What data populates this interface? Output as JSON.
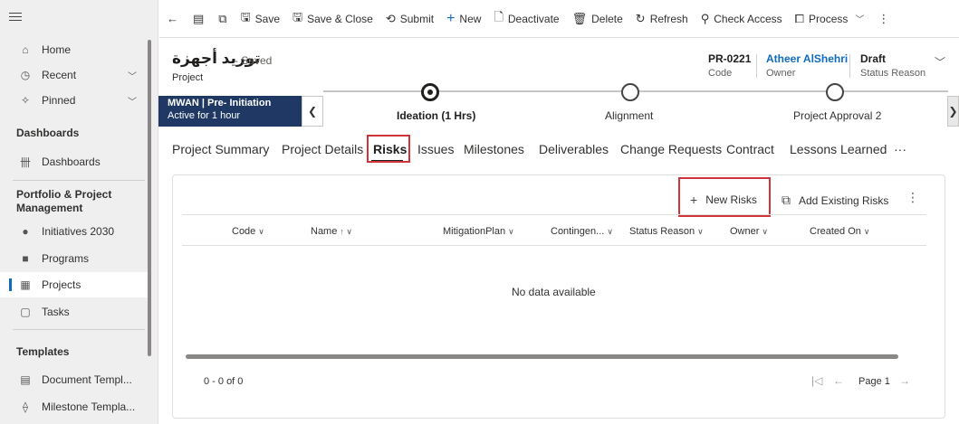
{
  "sidebar": {
    "items": [
      {
        "label": "Home",
        "icon": "home-icon"
      },
      {
        "label": "Recent",
        "icon": "clock-icon"
      },
      {
        "label": "Pinned",
        "icon": "pin-icon"
      }
    ],
    "section_dashboards": "Dashboards",
    "dashboards_item": "Dashboards",
    "section_portfolio": "Portfolio & Project Management",
    "portfolio_items": [
      {
        "label": "Initiatives 2030"
      },
      {
        "label": "Programs"
      },
      {
        "label": "Projects"
      },
      {
        "label": "Tasks"
      }
    ],
    "section_templates": "Templates",
    "template_items": [
      {
        "label": "Document Templ..."
      },
      {
        "label": "Milestone Templa..."
      }
    ]
  },
  "toolbar": {
    "save": "Save",
    "save_close": "Save & Close",
    "submit": "Submit",
    "new": "New",
    "deactivate": "Deactivate",
    "delete": "Delete",
    "refresh": "Refresh",
    "check_access": "Check Access",
    "process": "Process"
  },
  "header": {
    "title": "توريد أجهزة",
    "saved": "- Saved",
    "entity": "Project",
    "code_value": "PR-0221",
    "code_label": "Code",
    "owner_value": "Atheer AlShehri",
    "owner_label": "Owner",
    "status_value": "Draft",
    "status_label": "Status Reason"
  },
  "bpf": {
    "stage_name": "MWAN | Pre- Initiation",
    "stage_duration": "Active for 1 hour",
    "stages": [
      "Ideation  (1 Hrs)",
      "Alignment",
      "Project Approval 2"
    ]
  },
  "tabs": [
    "Project Summary",
    "Project Details",
    "Risks",
    "Issues",
    "Milestones",
    "Deliverables",
    "Change Requests",
    "Contract",
    "Lessons Learned",
    "···"
  ],
  "grid": {
    "new_button": "New Risks",
    "add_existing": "Add Existing Risks",
    "columns": [
      "Code",
      "Name",
      "MitigationPlan",
      "Contingen...",
      "Status Reason",
      "Owner",
      "Created On"
    ],
    "empty": "No data available",
    "count": "0 - 0 of 0",
    "page": "Page 1"
  },
  "colors": {
    "accent": "#0f6cbd",
    "stage_bg": "#1f3864",
    "highlight": "#d13438"
  }
}
